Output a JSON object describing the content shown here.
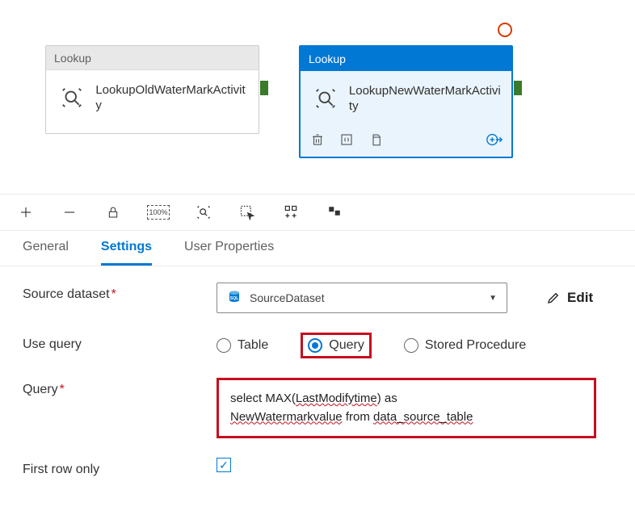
{
  "canvas": {
    "activities": [
      {
        "type_label": "Lookup",
        "title": "LookupOldWaterMarkActivity"
      },
      {
        "type_label": "Lookup",
        "title": "LookupNewWaterMarkActivity"
      }
    ]
  },
  "tabs": {
    "items": [
      "General",
      "Settings",
      "User Properties"
    ],
    "active_index": 1
  },
  "form": {
    "source_dataset_label": "Source dataset",
    "source_dataset_value": "SourceDataset",
    "edit_label": "Edit",
    "use_query_label": "Use query",
    "use_query_options": [
      "Table",
      "Query",
      "Stored Procedure"
    ],
    "use_query_selected": "Query",
    "query_label": "Query",
    "query_value_parts": [
      {
        "text": "select MAX(",
        "wavy": false
      },
      {
        "text": "LastModifytime",
        "wavy": true
      },
      {
        "text": ") as ",
        "wavy": false
      },
      {
        "text": "NewWatermarkvalue",
        "wavy": true
      },
      {
        "text": " from ",
        "wavy": false
      },
      {
        "text": "data_source_table",
        "wavy": true
      }
    ],
    "first_row_only_label": "First row only",
    "first_row_only_checked": true
  }
}
